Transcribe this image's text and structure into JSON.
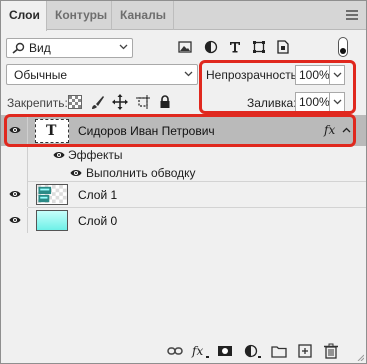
{
  "tabs": [
    {
      "label": "Слои",
      "active": true
    },
    {
      "label": "Контуры",
      "active": false
    },
    {
      "label": "Каналы",
      "active": false
    }
  ],
  "filter": {
    "label": "Вид",
    "icons": [
      "image-filter-icon",
      "adjustment-filter-icon",
      "type-filter-icon",
      "shape-filter-icon",
      "smart-object-filter-icon"
    ]
  },
  "blend": {
    "mode": "Обычные",
    "opacity_label": "Непрозрачность:",
    "opacity_value": "100%",
    "fill_label": "Заливка:",
    "fill_value": "100%"
  },
  "lock": {
    "label": "Закрепить:",
    "icons": [
      "lock-transparent-pixels-icon",
      "lock-image-pixels-icon",
      "lock-position-icon",
      "lock-artboard-icon",
      "lock-all-icon"
    ]
  },
  "layers": [
    {
      "name": "Сидоров Иван Петрович",
      "type": "text",
      "selected": true,
      "fx": "fx",
      "thumb_label": "T"
    },
    {
      "name": "Эффекты",
      "type": "effects-header"
    },
    {
      "name": "Выполнить обводку",
      "type": "effect"
    },
    {
      "name": "Слой 1",
      "type": "raster"
    },
    {
      "name": "Слой 0",
      "type": "raster-gradient"
    }
  ],
  "bottom_toolbar": [
    "link-layers-icon",
    "fx-icon",
    "mask-icon",
    "adjustment-layer-icon",
    "group-folder-icon",
    "new-layer-icon",
    "delete-layer-icon"
  ],
  "colors": {
    "highlight": "#e0281e",
    "selected_row": "#bababa",
    "layer0_gradient": "#7ef5ee"
  }
}
